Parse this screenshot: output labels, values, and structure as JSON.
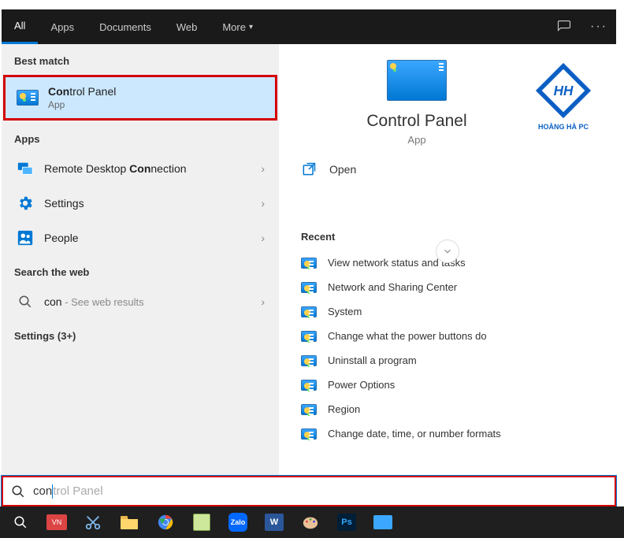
{
  "tabs": {
    "all": "All",
    "apps": "Apps",
    "documents": "Documents",
    "web": "Web",
    "more": "More"
  },
  "groups": {
    "best_match": "Best match",
    "apps": "Apps",
    "search_web": "Search the web",
    "settings_more": "Settings (3+)"
  },
  "best_match": {
    "title_prefix": "Con",
    "title_rest": "trol Panel",
    "subtitle": "App"
  },
  "app_results": [
    {
      "icon": "remote-desktop",
      "title_pre": "Remote Desktop ",
      "title_bold": "Con",
      "title_post": "nection"
    },
    {
      "icon": "settings",
      "title_pre": "",
      "title_bold": "",
      "title_post": "Settings"
    },
    {
      "icon": "people",
      "title_pre": "",
      "title_bold": "",
      "title_post": "People"
    }
  ],
  "web_result": {
    "query": "con",
    "suffix": " - See web results"
  },
  "preview": {
    "title": "Control Panel",
    "subtitle": "App",
    "open_label": "Open",
    "recent_header": "Recent",
    "recent": [
      "View network status and tasks",
      "Network and Sharing Center",
      "System",
      "Change what the power buttons do",
      "Uninstall a program",
      "Power Options",
      "Region",
      "Change date, time, or number formats"
    ],
    "brand_text": "HOÀNG HÀ PC"
  },
  "search_box": {
    "typed": "con",
    "ghost": "trol Panel"
  },
  "taskbar_icons": [
    "search",
    "unikey",
    "snip",
    "explorer",
    "chrome",
    "notepadpp",
    "zalo",
    "word",
    "paint",
    "photoshop",
    "other"
  ]
}
